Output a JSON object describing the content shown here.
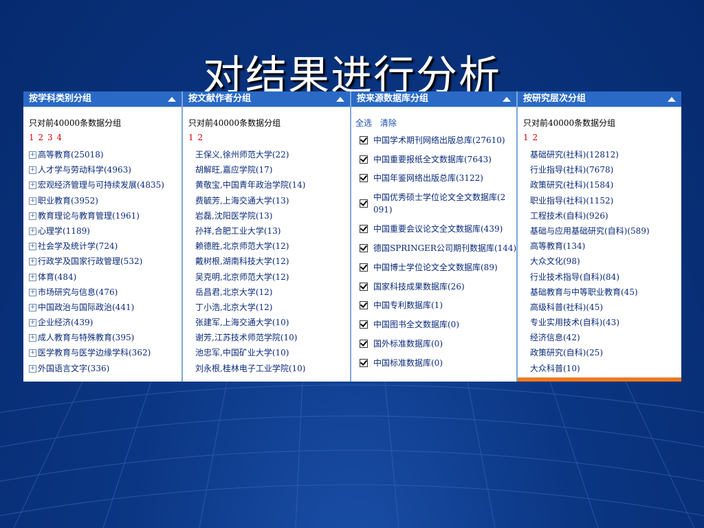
{
  "slide": {
    "title": "对结果进行分析"
  },
  "colors": {
    "header": "#2a6ac6",
    "page_numbers": "#d00000",
    "links": "#1a4fb0",
    "accent_bar": "#f07a20"
  },
  "subject": {
    "header": "按学科类别分组",
    "note": "只对前40000条数据分组",
    "pages": [
      "1",
      "2",
      "3",
      "4"
    ],
    "items": [
      "高等教育(25018)",
      "人才学与劳动科学(4963)",
      "宏观经济管理与可持续发展(4835)",
      "职业教育(3952)",
      "教育理论与教育管理(1961)",
      "心理学(1189)",
      "社会学及统计学(724)",
      "行政学及国家行政管理(532)",
      "体育(484)",
      "市场研究与信息(476)",
      "中国政治与国际政治(441)",
      "企业经济(439)",
      "成人教育与特殊教育(395)",
      "医学教育与医学边缘学科(362)",
      "外国语言文字(336)"
    ]
  },
  "author": {
    "header": "按文献作者分组",
    "note": "只对前40000条数据分组",
    "pages": [
      "1",
      "2"
    ],
    "items": [
      "王保义,徐州师范大学(22)",
      "胡解旺,嘉应学院(17)",
      "黄敬宝,中国青年政治学院(14)",
      "费毓芳,上海交通大学(13)",
      "岩磊,沈阳医学院(13)",
      "孙祥,合肥工业大学(13)",
      "赖德胜,北京师范大学(12)",
      "戴树根,湖南科技大学(12)",
      "吴克明,北京师范大学(12)",
      "岳昌君,北京大学(12)",
      "丁小浩,北京大学(12)",
      "张建军,上海交通大学(10)",
      "谢芳,江苏技术师范学院(10)",
      "池忠军,中国矿业大学(10)",
      "刘永根,桂林电子工业学院(10)"
    ]
  },
  "source": {
    "header": "按来源数据库分组",
    "select_all": "全选",
    "clear": "清除",
    "items": [
      {
        "label": "中国学术期刊网络出版总库(27610)",
        "checked": true
      },
      {
        "label": "中国重要报纸全文数据库(7643)",
        "checked": true
      },
      {
        "label": "中国年鉴网络出版总库(3122)",
        "checked": true
      },
      {
        "label": "中国优秀硕士学位论文全文数据库(2",
        "label2": "091)",
        "checked": true
      },
      {
        "label": "中国重要会议论文全文数据库(439)",
        "checked": true
      },
      {
        "label": "德国SPRINGER公司期刊数据库(144)",
        "checked": true
      },
      {
        "label": "中国博士学位论文全文数据库(89)",
        "checked": true
      },
      {
        "label": "国家科技成果数据库(26)",
        "checked": true
      },
      {
        "label": "中国专利数据库(1)",
        "checked": true
      },
      {
        "label": "中国图书全文数据库(0)",
        "checked": true
      },
      {
        "label": "国外标准数据库(0)",
        "checked": true
      },
      {
        "label": "中国标准数据库(0)",
        "checked": true
      }
    ]
  },
  "level": {
    "header": "按研究层次分组",
    "note": "只对前40000条数据分组",
    "pages": [
      "1",
      "2"
    ],
    "items": [
      "基础研究(社科)(12812)",
      "行业指导(社科)(7678)",
      "政策研究(社科)(1584)",
      "职业指导(社科)(1152)",
      "工程技术(自科)(926)",
      "基础与应用基础研究(自科)(589)",
      "高等教育(134)",
      "大众文化(98)",
      "行业技术指导(自科)(84)",
      "基础教育与中等职业教育(45)",
      "高级科普(社科)(45)",
      "专业实用技术(自科)(43)",
      "经济信息(42)",
      "政策研究(自科)(25)",
      "大众科普(10)"
    ]
  }
}
